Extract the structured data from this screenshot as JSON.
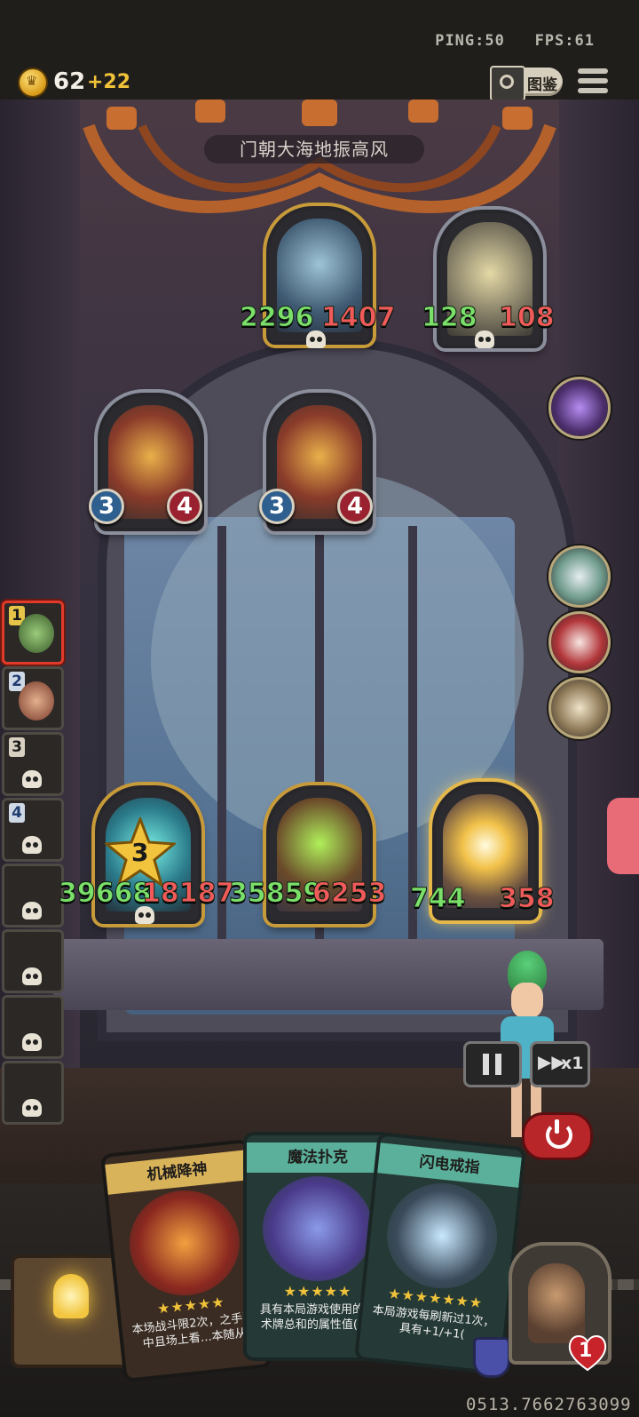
{
  "status": {
    "ping_label": "PING:50",
    "fps_label": "FPS:61"
  },
  "currency": {
    "coins": "62",
    "bonus": "+22"
  },
  "top_buttons": {
    "codex_label": "图鉴"
  },
  "board": {
    "title": "门朝大海地振高风",
    "enemies": [
      {
        "attack": "2296",
        "health": "1407"
      },
      {
        "attack": "128",
        "health": "108"
      }
    ],
    "enemy_minions": [
      {
        "attack": "3",
        "health": "4"
      },
      {
        "attack": "3",
        "health": "4"
      }
    ],
    "allies": [
      {
        "attack": "39668",
        "health": "18187",
        "star_level": "3"
      },
      {
        "attack": "35859",
        "health": "6253"
      },
      {
        "attack": "744",
        "health": "358"
      }
    ]
  },
  "turn_queue": [
    "1",
    "2",
    "3",
    "4"
  ],
  "speed_button": {
    "label": "x1"
  },
  "hand": [
    {
      "title": "机械降神",
      "stars": "★★★★★",
      "desc": "本场战斗限2次，之手牌中且场上看…本随从"
    },
    {
      "title": "魔法扑克",
      "stars": "★★★★★",
      "desc": "具有本局游戏使用的咒术牌总和的属性值(+3"
    },
    {
      "title": "闪电戒指",
      "stars": "★★★★★★★",
      "desc": "本局游戏每刷新过1次，具有+1/+1("
    }
  ],
  "player": {
    "lives": "1"
  },
  "serial": "0513.7662763099",
  "colors": {
    "attack": "#7be06a",
    "health": "#f05a5a",
    "gold_frame": "#c79a3a",
    "danger": "#b8262a"
  }
}
